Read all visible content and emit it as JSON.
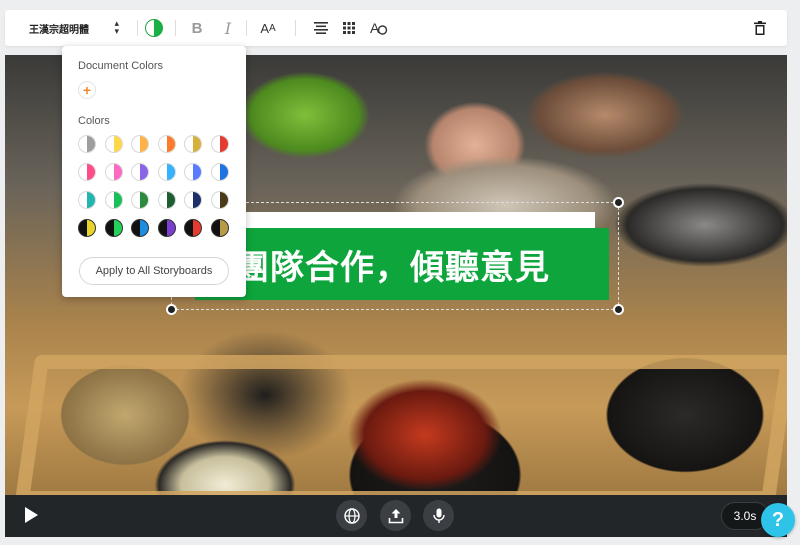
{
  "toolbar": {
    "font_name": "王漢宗超明體",
    "text_color": "#17b243",
    "bold_label": "B",
    "italic_label": "I",
    "size_label_big": "A",
    "size_label_small": "A"
  },
  "canvas": {
    "title_text": "團隊合作，傾聽意見",
    "banner_color": "#0ea53c"
  },
  "color_panel": {
    "document_colors_heading": "Document Colors",
    "add_symbol": "+",
    "colors_heading": "Colors",
    "swatches": [
      [
        "#9e9e9e",
        "#ffd84a",
        "#ffb347",
        "#ff7a2b",
        "#d6b13a",
        "#e53a2f"
      ],
      [
        "#ff4d8a",
        "#ff6ac1",
        "#8a66e6",
        "#36b1ff",
        "#5a7bff",
        "#1f73e0"
      ],
      [
        "#23b6b0",
        "#1bbf5a",
        "#2b8a3e",
        "#1f5e33",
        "#1b2f6b",
        "#4a3a1a"
      ],
      [
        "#e8d32a",
        "#24d15a",
        "#1e8de0",
        "#7a3fd0",
        "#e53a2f",
        "#b89a4a"
      ]
    ],
    "apply_label": "Apply to All Storyboards"
  },
  "player": {
    "duration": "3.0s",
    "help_label": "?"
  }
}
